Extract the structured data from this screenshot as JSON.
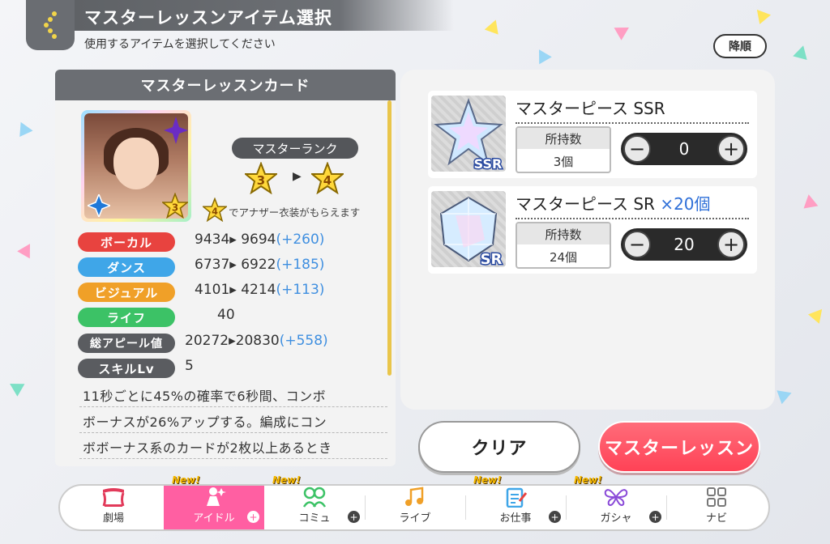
{
  "header": {
    "title": "マスターレッスンアイテム選択",
    "subtitle": "使用するアイテムを選択してください",
    "sort_label": "降順"
  },
  "card_panel": {
    "heading": "マスターレッスンカード",
    "card_rank": "3",
    "master_rank_label": "マスターランク",
    "rank_from": "3",
    "rank_to": "4",
    "note_star": "4",
    "note": "でアナザー衣装がもらえます",
    "stats": [
      {
        "label": "ボーカル",
        "from": "9434",
        "to": "9694",
        "diff": "(+260)",
        "color": "#e8433f"
      },
      {
        "label": "ダンス",
        "from": "6737",
        "to": "6922",
        "diff": "(+185)",
        "color": "#3fa6e8"
      },
      {
        "label": "ビジュアル",
        "from": "4101",
        "to": "4214",
        "diff": "(+113)",
        "color": "#f0a028"
      },
      {
        "label": "ライフ",
        "value": "40",
        "color": "#3cc266"
      },
      {
        "label": "総アピール値",
        "from": "20272",
        "to": "20830",
        "diff": "(+558)",
        "color": "#5a5c60"
      },
      {
        "label": "スキルLv",
        "value": "5",
        "color": "#5a5c60"
      }
    ],
    "description": [
      "11秒ごとに45%の確率で6秒間、コンボ",
      "ボーナスが26%アップする。編成にコン",
      "ボボーナス系のカードが2枚以上あるとき"
    ]
  },
  "items": [
    {
      "name": "マスターピース SSR",
      "multiplier": "",
      "badge": "SSR",
      "own_label": "所持数",
      "own_value": "3個",
      "count": "0"
    },
    {
      "name": "マスターピース SR",
      "multiplier": "×20個",
      "badge": "SR",
      "own_label": "所持数",
      "own_value": "24個",
      "count": "20"
    }
  ],
  "buttons": {
    "clear": "クリア",
    "master_lesson": "マスターレッスン"
  },
  "nav": {
    "new_label": "New!",
    "items": [
      {
        "label": "劇場",
        "icon": "theater-icon"
      },
      {
        "label": "アイドル",
        "icon": "idol-icon",
        "active": true,
        "new": true
      },
      {
        "label": "コミュ",
        "icon": "commu-icon",
        "new": true
      },
      {
        "label": "ライブ",
        "icon": "live-icon"
      },
      {
        "label": "お仕事",
        "icon": "work-icon",
        "new": true
      },
      {
        "label": "ガシャ",
        "icon": "gacha-icon",
        "new": true
      },
      {
        "label": "ナビ",
        "icon": "navi-icon"
      }
    ]
  },
  "colors": {
    "accent_pink": "#ff5fa2",
    "master_button": "#ff4f61",
    "plus_blue": "#3f8fe0"
  }
}
